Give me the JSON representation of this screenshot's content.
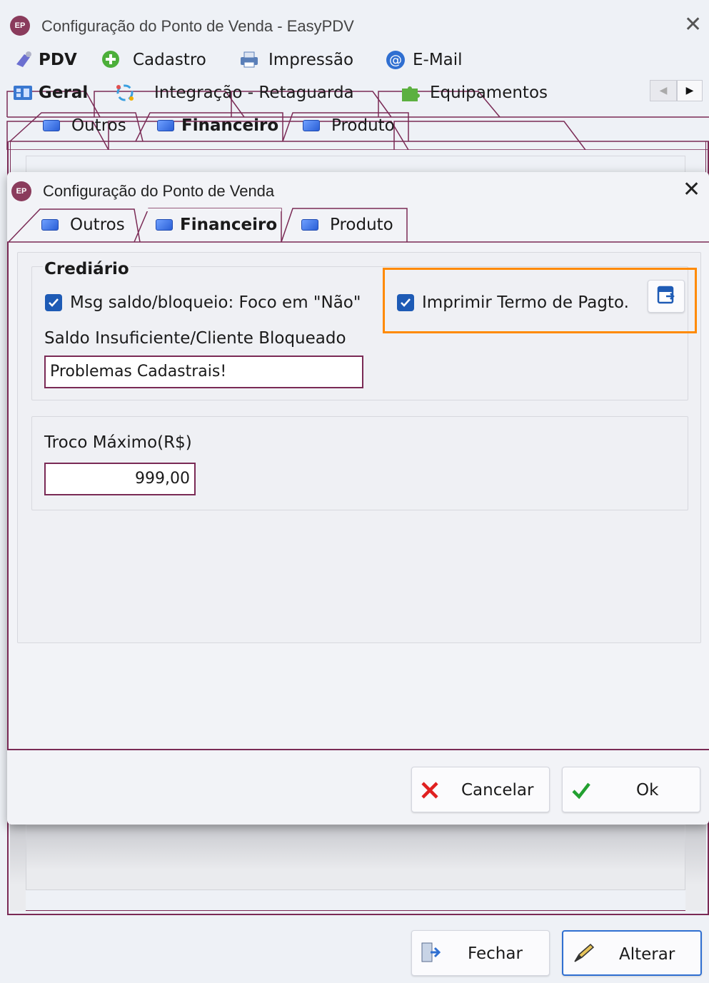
{
  "background_window": {
    "title": "Configuração do Ponto de Venda - EasyPDV",
    "app_icon_text": "EP",
    "main_tabs": [
      "PDV",
      "Cadastro",
      "Impressão",
      "E-Mail"
    ],
    "sub_tabs": [
      "Geral",
      "Integração - Retaguarda",
      "Equipamentos"
    ],
    "inner_tabs": [
      "Outros",
      "Financeiro",
      "Produto"
    ],
    "buttons": {
      "close": "Fechar",
      "edit": "Alterar"
    }
  },
  "dialog": {
    "title": "Configuração do Ponto de Venda",
    "app_icon_text": "EP",
    "tabs": [
      "Outros",
      "Financeiro",
      "Produto"
    ],
    "active_tab": "Financeiro",
    "crediario": {
      "group_title": "Crediário",
      "msg_checkbox_label": "Msg saldo/bloqueio: Foco em \"Não\"",
      "msg_checked": true,
      "print_checkbox_label": "Imprimir Termo de Pagto.",
      "print_checked": true,
      "saldo_label": "Saldo Insuficiente/Cliente Bloqueado",
      "saldo_value": "Problemas Cadastrais!"
    },
    "troco": {
      "label": "Troco Máximo(R$)",
      "value": "999,00"
    },
    "buttons": {
      "cancel": "Cancelar",
      "ok": "Ok"
    },
    "highlight_color": "#ff8a00"
  }
}
